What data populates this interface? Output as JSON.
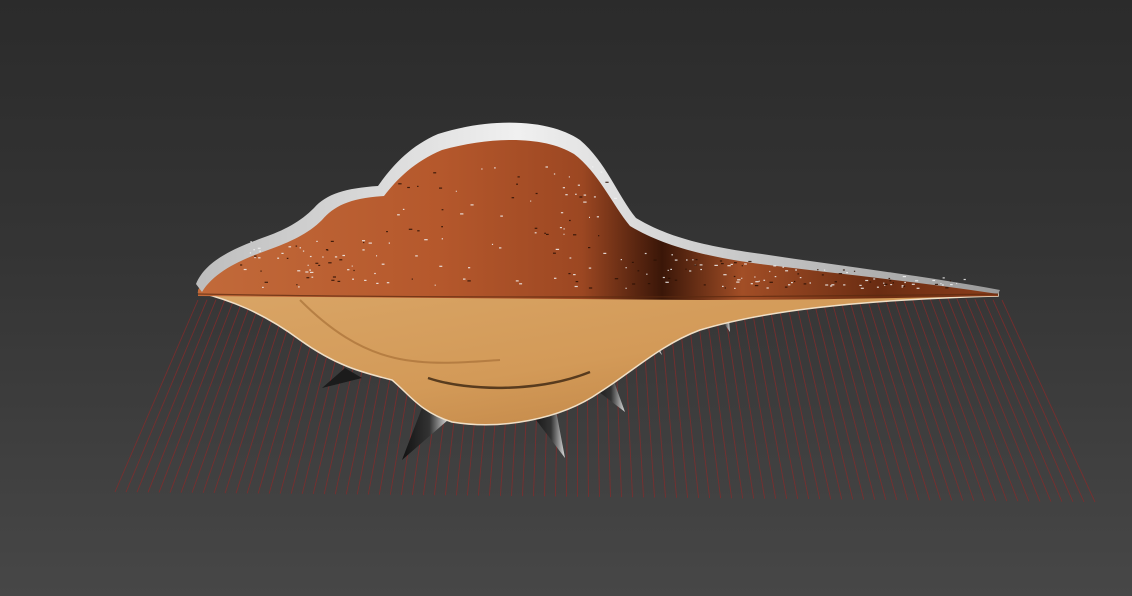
{
  "viewport": {
    "background_top": "#2b2b2b",
    "background_bottom": "#474747"
  },
  "scene": {
    "object": "shell-model",
    "colors": {
      "upper_shell": "#b5582c",
      "upper_shell_dark": "#3a1608",
      "lower_shell": "#d7a262",
      "lower_shell_dark": "#8a5a2a",
      "rim_highlight": "#e3e3e3",
      "spike": "#1a1a1a",
      "spike_highlight": "#d9d9d9",
      "grid_lines": "#8a2a2a"
    }
  }
}
